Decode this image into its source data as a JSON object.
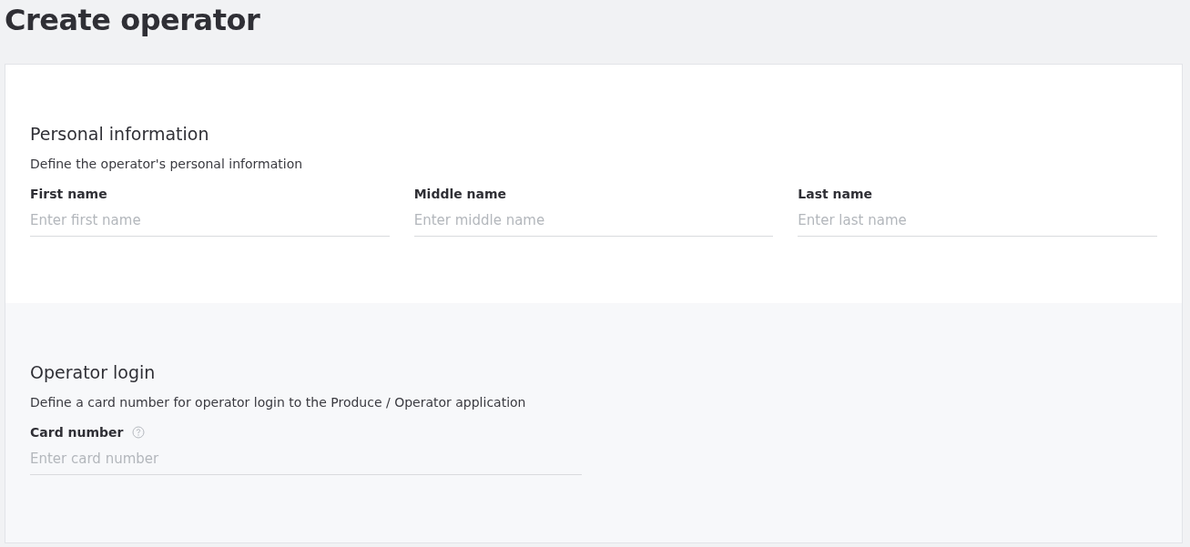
{
  "title": "Create operator",
  "sections": [
    {
      "heading": "Personal information",
      "description": "Define the operator's personal information",
      "fields": [
        {
          "label": "First name",
          "placeholder": "Enter first name",
          "help": false
        },
        {
          "label": "Middle name",
          "placeholder": "Enter middle name",
          "help": false
        },
        {
          "label": "Last name",
          "placeholder": "Enter last name",
          "help": false
        }
      ]
    },
    {
      "heading": "Operator login",
      "description": "Define a card number for operator login to the Produce / Operator application",
      "fields": [
        {
          "label": "Card number",
          "placeholder": "Enter card number",
          "help": true
        }
      ]
    }
  ]
}
